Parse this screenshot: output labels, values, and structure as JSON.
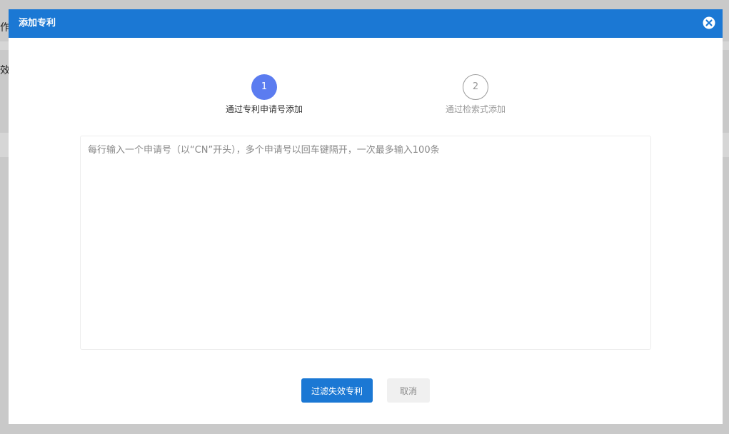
{
  "background": {
    "text_fragment_1": "作费",
    "text_fragment_2": "效"
  },
  "dialog": {
    "title": "添加专利",
    "close_icon": "close-circle-icon"
  },
  "steps": [
    {
      "number": "1",
      "label": "通过专利申请号添加",
      "active": true
    },
    {
      "number": "2",
      "label": "通过检索式添加",
      "active": false
    }
  ],
  "input": {
    "placeholder": "每行输入一个申请号（以“CN”开头），多个申请号以回车键隔开，一次最多输入100条",
    "value": ""
  },
  "buttons": {
    "filter_label": "过滤失效专利",
    "cancel_label": "取消"
  },
  "colors": {
    "header": "#1b78d4",
    "step_active": "#5b7cf0",
    "primary_button": "#1b78d4"
  }
}
